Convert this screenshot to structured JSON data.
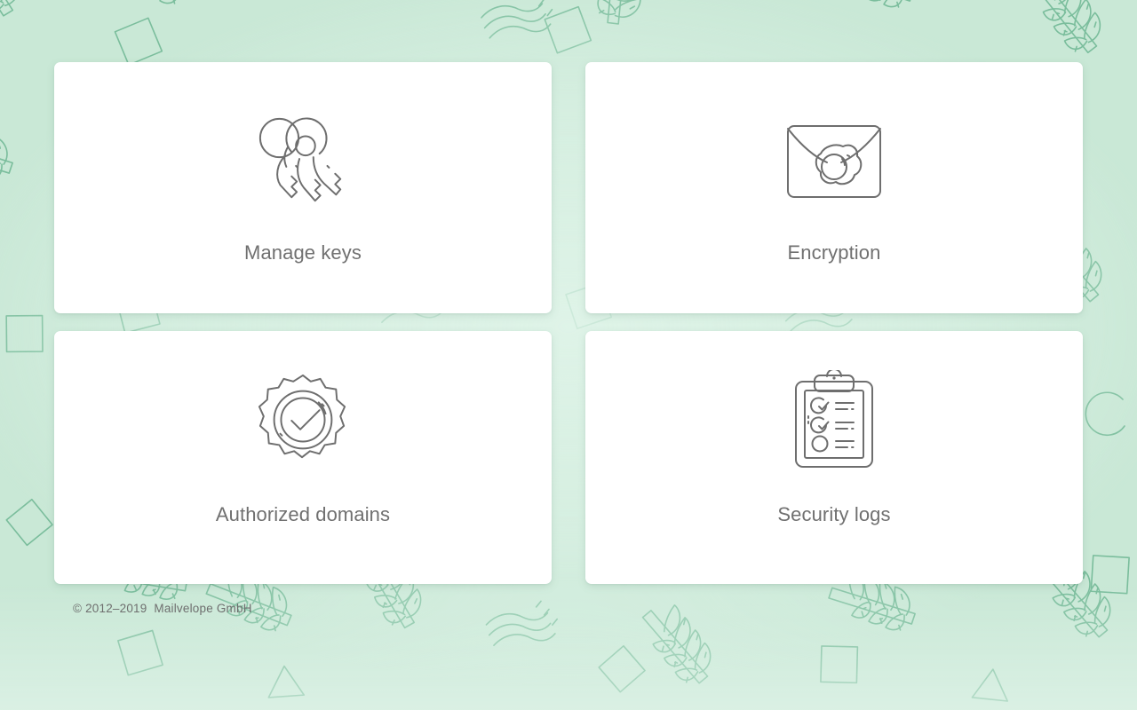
{
  "page": {
    "background_color": "#c9e8d6",
    "pattern_stroke_color": "#76bb99",
    "card_color": "#ffffff",
    "icon_stroke_color": "#6e6e6e",
    "label_color": "#707070"
  },
  "tiles": [
    {
      "id": "manage-keys",
      "label": "Manage keys",
      "icon": "keys-icon"
    },
    {
      "id": "encryption",
      "label": "Encryption",
      "icon": "sealed-envelope-icon"
    },
    {
      "id": "authorized-domains",
      "label": "Authorized domains",
      "icon": "verified-badge-icon"
    },
    {
      "id": "security-logs",
      "label": "Security logs",
      "icon": "clipboard-checklist-icon"
    }
  ],
  "footer": {
    "copyright": "© 2012–2019  Mailvelope GmbH"
  }
}
